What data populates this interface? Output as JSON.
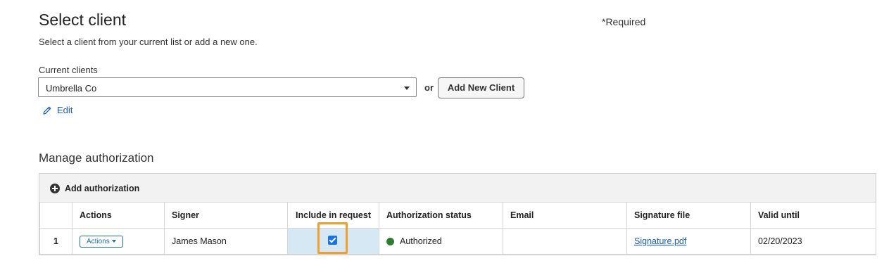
{
  "header": {
    "title": "Select client",
    "required_note": "*Required",
    "subtitle": "Select a client from your current list or add a new one."
  },
  "client_select": {
    "label": "Current clients",
    "selected_value": "Umbrella Co",
    "or_text": "or",
    "add_button_label": "Add New Client",
    "edit_label": "Edit"
  },
  "authorization": {
    "section_title": "Manage authorization",
    "add_label": "Add authorization",
    "columns": [
      "",
      "Actions",
      "Signer",
      "Include in request",
      "Authorization status",
      "Email",
      "Signature file",
      "Valid until"
    ],
    "rows": [
      {
        "index": "1",
        "actions_label": "Actions",
        "signer": "James Mason",
        "include": true,
        "status": "Authorized",
        "email": "",
        "signature_file": "Signature.pdf",
        "valid_until": "02/20/2023"
      }
    ]
  },
  "colors": {
    "link": "#1a5fa8",
    "status_authorized": "#2e7d32",
    "highlight": "#f0a02a",
    "include_cell_bg": "#d5e8f3"
  },
  "icons": {
    "edit": "pencil-icon",
    "add": "plus-circle-icon",
    "dropdown": "caret-down-icon",
    "actions_dropdown": "triangle-down-icon"
  }
}
